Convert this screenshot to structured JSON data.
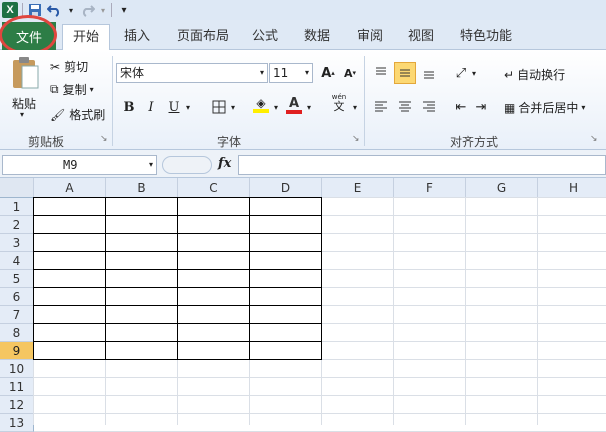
{
  "qat": {
    "excel_icon": "X"
  },
  "tabs": {
    "file": "文件",
    "home": "开始",
    "insert": "插入",
    "page_layout": "页面布局",
    "formulas": "公式",
    "data": "数据",
    "review": "审阅",
    "view": "视图",
    "special": "特色功能"
  },
  "clipboard": {
    "paste": "粘贴",
    "cut": "剪切",
    "copy": "复制",
    "format_painter": "格式刷",
    "label": "剪贴板"
  },
  "font": {
    "name": "宋体",
    "size": "11",
    "label": "字体",
    "bold": "B",
    "italic": "I",
    "underline": "U",
    "wen": "wén",
    "wen_char": "文"
  },
  "alignment": {
    "wrap_text": "自动换行",
    "merge_center": "合并后居中",
    "label": "对齐方式"
  },
  "formula_bar": {
    "name_box": "M9",
    "fx": "fx"
  },
  "sheet": {
    "columns": [
      "A",
      "B",
      "C",
      "D",
      "E",
      "F",
      "G",
      "H"
    ],
    "rows": [
      "1",
      "2",
      "3",
      "4",
      "5",
      "6",
      "7",
      "8",
      "9",
      "10",
      "11",
      "12",
      "13"
    ],
    "selected_row": "9"
  },
  "colors": {
    "file_tab": "#2d7d46",
    "highlight_circle": "#e0463f",
    "font_color_bar": "#e02020",
    "fill_color_bar": "#ffef00"
  }
}
